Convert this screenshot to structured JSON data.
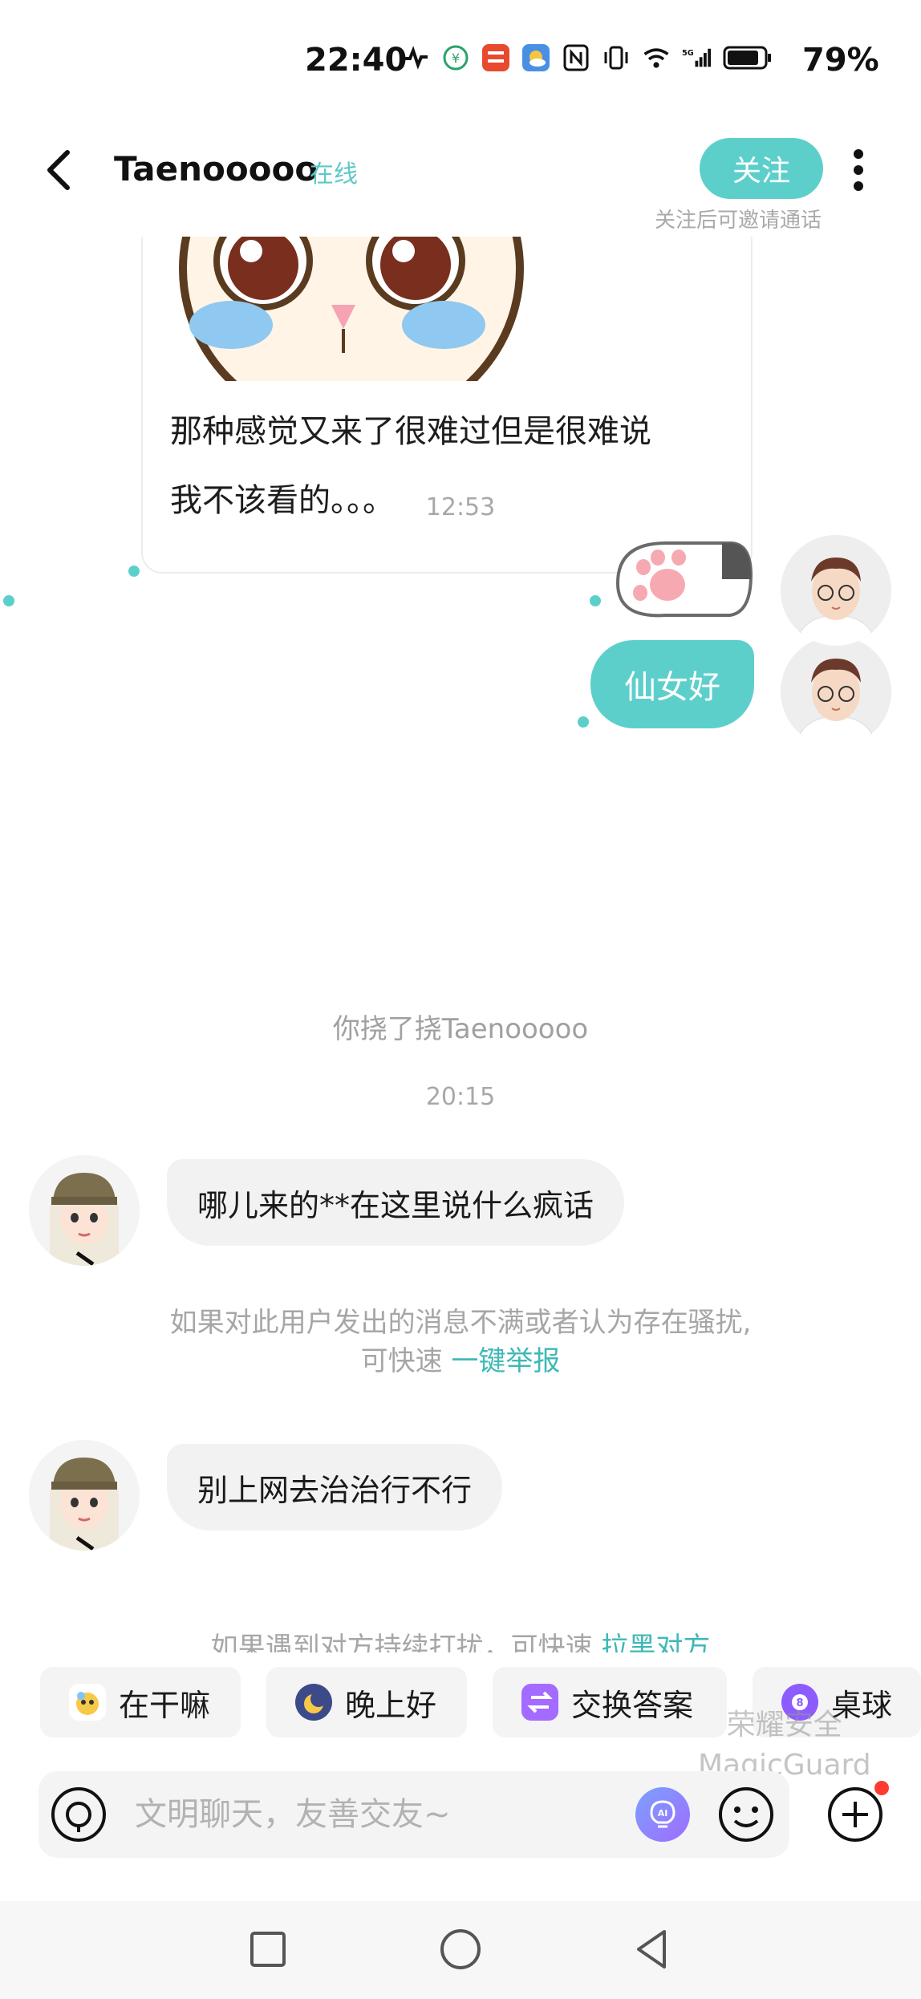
{
  "status_bar": {
    "time": "22:40",
    "battery": "79%",
    "icons": [
      "heartbeat-icon",
      "wallet-icon",
      "bank-app-icon",
      "weather-icon",
      "nfc-icon",
      "vibrate-icon",
      "wifi-icon",
      "signal-5g-icon",
      "battery-icon"
    ]
  },
  "header": {
    "back_icon": "chevron-left-icon",
    "title": "Taenooooo",
    "online": "在线",
    "follow_label": "关注",
    "follow_hint": "关注后可邀请通话",
    "more_icon": "more-vertical-icon"
  },
  "messages": {
    "card_text": "那种感觉又来了很难过但是很难说 我不该看的。。。",
    "greeting": "仙女好",
    "time1": "12:53",
    "poke": "你挠了挠Taenooooo",
    "time2": "20:15",
    "incoming1": "哪儿来的**在这里说什么疯话",
    "notice1_line1": "如果对此用户发出的消息不满或者认为存在骚扰,",
    "notice1_prefix": "可快速 ",
    "notice1_link": "一键举报",
    "incoming2": "别上网去治治行不行",
    "notice2_prefix": "如果遇到对方持续打扰，可快速 ",
    "notice2_link": "拉黑对方"
  },
  "quick_replies": [
    {
      "label": "在干嘛",
      "icon": "emoji-sticker-icon"
    },
    {
      "label": "晚上好",
      "icon": "moon-icon"
    },
    {
      "label": "交换答案",
      "icon": "exchange-icon"
    },
    {
      "label": "桌球",
      "icon": "billiard-ball-icon"
    }
  ],
  "watermark": {
    "line1": "荣耀安全",
    "line2": "MagicGuard"
  },
  "input": {
    "placeholder": "文明聊天，友善交友~",
    "value": ""
  },
  "colors": {
    "accent": "#5dcfcb",
    "link": "#3fb8b6",
    "bubble_incoming": "#f2f2f2"
  }
}
